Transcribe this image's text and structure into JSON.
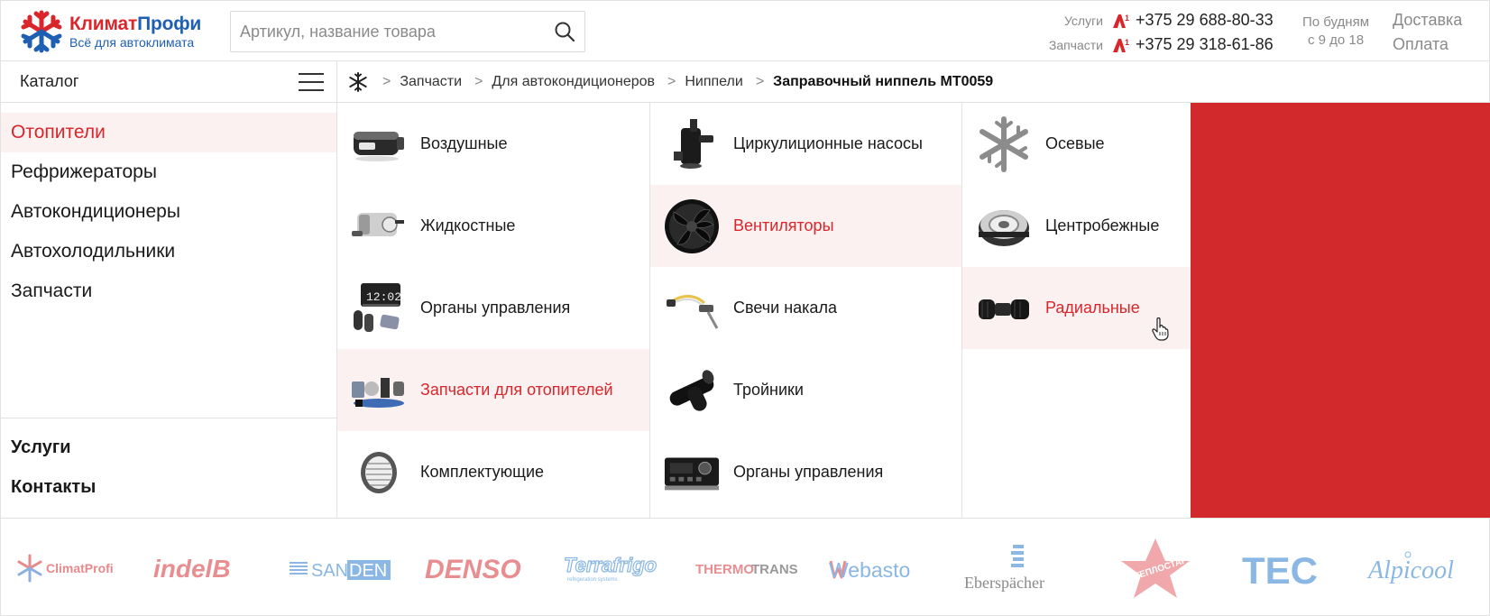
{
  "header": {
    "logo": {
      "name_part1": "Климат",
      "name_part2": "Профи",
      "tagline": "Всё для автоклимата"
    },
    "search": {
      "placeholder": "Артикул, название товара"
    },
    "phones": [
      {
        "label": "Услуги",
        "number": "+375 29 688-80-33"
      },
      {
        "label": "Запчасти",
        "number": "+375 29 318-61-86"
      }
    ],
    "hours": {
      "line1": "По будням",
      "line2": "с 9 до 18"
    },
    "links": {
      "delivery": "Доставка",
      "payment": "Оплата"
    }
  },
  "catalog": {
    "title": "Каталог"
  },
  "breadcrumb": {
    "items": [
      "Запчасти",
      "Для автокондиционеров",
      "Ниппели"
    ],
    "current": "Заправочный ниппель МТ0059"
  },
  "left_menu": {
    "items": [
      "Отопители",
      "Рефрижераторы",
      "Автокондиционеры",
      "Автохолодильники",
      "Запчасти"
    ],
    "active_index": 0,
    "bottom": [
      "Услуги",
      "Контакты"
    ]
  },
  "columns": {
    "col1": [
      "Воздушные",
      "Жидкостные",
      "Органы управления",
      "Запчасти для отопителей",
      "Комплектующие"
    ],
    "col2": [
      "Циркулиционные насосы",
      "Вентиляторы",
      "Свечи накала",
      "Тройники",
      "Органы управления"
    ],
    "col3": [
      "Осевые",
      "Центробежные",
      "Радиальные"
    ]
  },
  "brands": {
    "climatprofi": "ClimatProfi",
    "indelb": "indelB",
    "sanden_1": "SAN",
    "sanden_2": "DEN",
    "denso": "DENSO",
    "terrafrigo": "Terrafrigo",
    "terrafrigo_sub": "refrigeration systems",
    "thermotrans_1": "THERMO",
    "thermotrans_2": "TRANS",
    "webasto": "Webasto",
    "eberspacher": "Eberspächer",
    "teplostar": "ТЕПЛОСТАР",
    "tec": "TEC",
    "alpicool": "Alpicool"
  },
  "colors": {
    "accent": "#d9262b",
    "brand_blue": "#1e5fb3",
    "highlight_bg": "#fbf1f1",
    "panel_red": "#d22a2c"
  }
}
